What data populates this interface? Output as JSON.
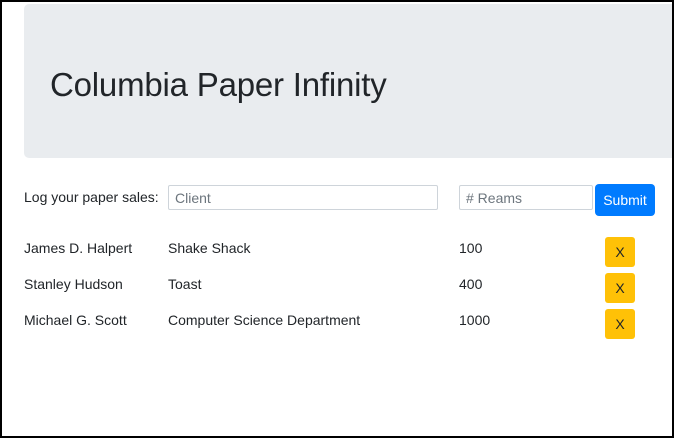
{
  "header": {
    "title": "Columbia Paper Infinity"
  },
  "form": {
    "label": "Log your paper sales:",
    "client_placeholder": "Client",
    "reams_placeholder": "# Reams",
    "submit_label": "Submit"
  },
  "sales": [
    {
      "name": "James D. Halpert",
      "client": "Shake Shack",
      "reams": "100",
      "delete_label": "X"
    },
    {
      "name": "Stanley Hudson",
      "client": "Toast",
      "reams": "400",
      "delete_label": "X"
    },
    {
      "name": "Michael G. Scott",
      "client": "Computer Science Department",
      "reams": "1000",
      "delete_label": "X"
    }
  ],
  "colors": {
    "jumbotron_bg": "#e9ecef",
    "primary": "#007bff",
    "warning": "#ffc107",
    "text": "#212529"
  }
}
